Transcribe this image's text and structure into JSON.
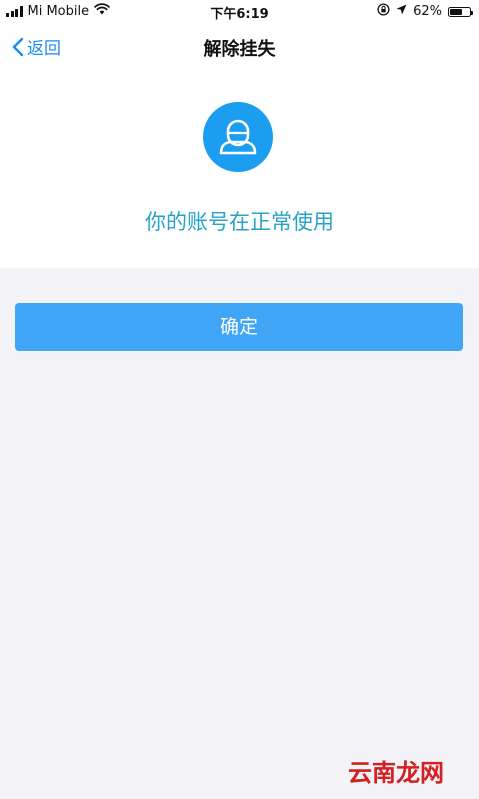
{
  "status_bar": {
    "carrier": "Mi Mobile",
    "time": "下午6:19",
    "battery_percent": "62%",
    "battery_level": 0.62,
    "icons": [
      "signal-icon",
      "wifi-icon",
      "orientation-lock-icon",
      "location-icon",
      "battery-icon"
    ]
  },
  "nav": {
    "back_label": "返回",
    "title": "解除挂失"
  },
  "account": {
    "status_text": "你的账号在正常使用",
    "avatar_icon": "user-icon"
  },
  "actions": {
    "confirm_label": "确定"
  },
  "watermark": {
    "text": "云南龙网"
  },
  "colors": {
    "accent": "#1c8bf0",
    "avatar": "#1c9ef0",
    "status_text": "#27a3c9",
    "button": "#41a5f5",
    "background": "#f4f4f8"
  }
}
